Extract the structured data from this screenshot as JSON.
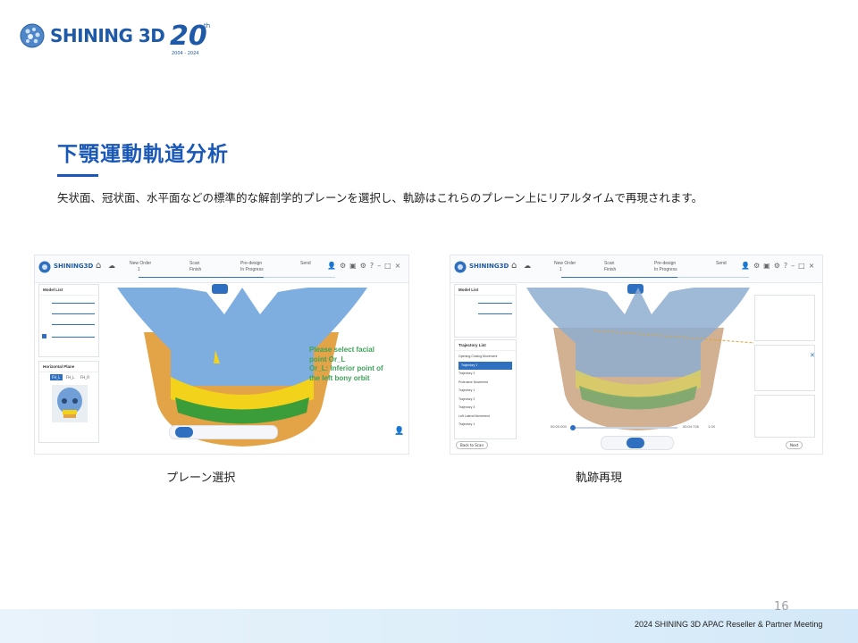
{
  "header": {
    "brand": "SHINING 3D",
    "anniversary_number": "20",
    "anniversary_sup": "th",
    "anniversary_years": "2004 - 2024"
  },
  "slide": {
    "title": "下顎運動軌道分析",
    "subtitle": "矢状面、冠状面、水平面などの標準的な解剖学的プレーンを選択し、軌跡はこれらのプレーン上にリアルタイムで再現されます。",
    "page_number": "16",
    "footer": "2024 SHINING 3D APAC Reseller & Partner Meeting"
  },
  "screenshots": {
    "left": {
      "caption": "プレーン選択",
      "app_brand": "SHINING3D",
      "steps": [
        "New Order",
        "Scan",
        "Pre-design",
        "Send"
      ],
      "step_sub": [
        "1",
        "Finish",
        "In Progress",
        ""
      ],
      "panel_model_list": "Model List",
      "panel_plane": "Horizontal Plane",
      "plane_tabs": [
        "FH_L",
        "FH_L",
        "FH_R"
      ],
      "prompt_lines": [
        "Please select facial",
        "point Or_L",
        "Or_L: Inferior point of",
        "the left bony orbit"
      ]
    },
    "right": {
      "caption": "軌跡再現",
      "app_brand": "SHINING3D",
      "steps": [
        "New Order",
        "Scan",
        "Pre-design",
        "Send"
      ],
      "step_sub": [
        "1",
        "Finish",
        "In Progress",
        ""
      ],
      "panel_model_list": "Model List",
      "panel_trajectory": "Trajectory List",
      "trajectory_items": [
        "Opening-Closing Movement",
        "Trajectory 1",
        "Trajectory 2",
        "Protrusive Movement",
        "Trajectory 1",
        "Trajectory 2",
        "Trajectory 3",
        "Left Lateral Movement",
        "Trajectory 1"
      ],
      "back_button": "Back to Scan",
      "next_button": "Next",
      "time_start": "00:00.000",
      "time_end": "00:04.726",
      "speed": "1.0X"
    }
  },
  "colors": {
    "brand_blue": "#1a58b8",
    "bone_blue": "#7eaee0",
    "jaw_orange": "#e3a347",
    "teeth_yellow": "#f3d21c",
    "gum_green": "#3a9d3a",
    "prompt_green": "#3fa25a"
  }
}
